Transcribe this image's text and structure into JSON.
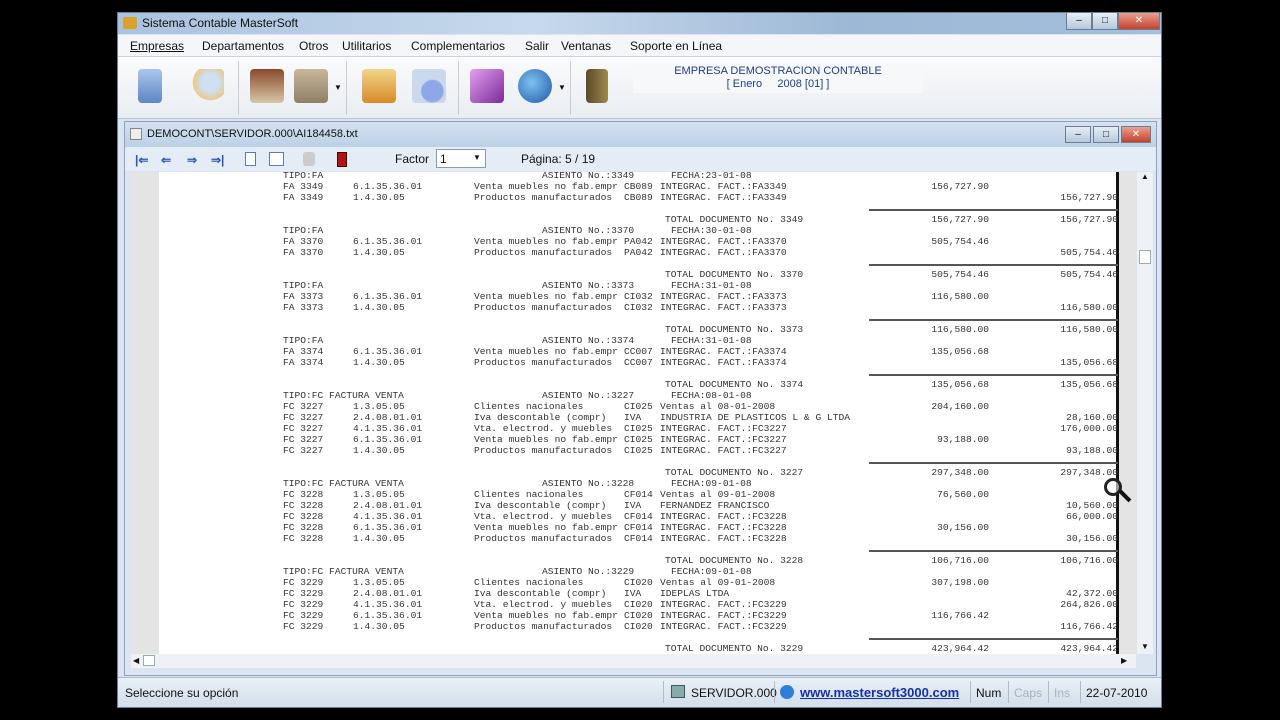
{
  "app": {
    "title": "Sistema Contable MasterSoft"
  },
  "menu": [
    "Empresas",
    "Departamentos",
    "Otros",
    "Utilitarios",
    "Complementarios",
    "Salir",
    "Ventanas",
    "Soporte en Línea"
  ],
  "toolbar": {
    "icons": [
      "calculator-icon",
      "search-documents-icon",
      "home-icon",
      "clock-folder-icon",
      "tools-folder-icon",
      "report-icon",
      "help-book-icon",
      "web-globe-icon",
      "exit-door-icon"
    ],
    "company_name": "EMPRESA DEMOSTRACION CONTABLE",
    "period": "[ Enero     2008 [01] ]"
  },
  "child": {
    "title": "DEMOCONT\\SERVIDOR.000\\AI184458.txt",
    "factor_label": "Factor",
    "factor_value": "1",
    "page_label": "Página: 5 / 19"
  },
  "document": {
    "lines": [
      {
        "k": "h",
        "tipo": "TIPO:FA",
        "asiento": "ASIENTO No.:3349",
        "fecha": "FECHA:23-01-08"
      },
      {
        "k": "e",
        "doc": "FA 3349",
        "cta": "6.1.35.36.01",
        "desc": "Venta muebles no fab.empr",
        "ref": "CB089",
        "det": "INTEGRAC. FACT.:FA3349",
        "debe": "156,727.90",
        "haber": ""
      },
      {
        "k": "e",
        "doc": "FA 3349",
        "cta": "1.4.30.05",
        "desc": "Productos manufacturados",
        "ref": "CB089",
        "det": "INTEGRAC. FACT.:FA3349",
        "debe": "",
        "haber": "156,727.90"
      },
      {
        "k": "r"
      },
      {
        "k": "t",
        "label": "TOTAL DOCUMENTO No. 3349",
        "debe": "156,727.90",
        "haber": "156,727.90"
      },
      {
        "k": "h",
        "tipo": "TIPO:FA",
        "asiento": "ASIENTO No.:3370",
        "fecha": "FECHA:30-01-08"
      },
      {
        "k": "e",
        "doc": "FA 3370",
        "cta": "6.1.35.36.01",
        "desc": "Venta muebles no fab.empr",
        "ref": "PA042",
        "det": "INTEGRAC. FACT.:FA3370",
        "debe": "505,754.46",
        "haber": ""
      },
      {
        "k": "e",
        "doc": "FA 3370",
        "cta": "1.4.30.05",
        "desc": "Productos manufacturados",
        "ref": "PA042",
        "det": "INTEGRAC. FACT.:FA3370",
        "debe": "",
        "haber": "505,754.46"
      },
      {
        "k": "r"
      },
      {
        "k": "t",
        "label": "TOTAL DOCUMENTO No. 3370",
        "debe": "505,754.46",
        "haber": "505,754.46"
      },
      {
        "k": "h",
        "tipo": "TIPO:FA",
        "asiento": "ASIENTO No.:3373",
        "fecha": "FECHA:31-01-08"
      },
      {
        "k": "e",
        "doc": "FA 3373",
        "cta": "6.1.35.36.01",
        "desc": "Venta muebles no fab.empr",
        "ref": "CI032",
        "det": "INTEGRAC. FACT.:FA3373",
        "debe": "116,580.00",
        "haber": ""
      },
      {
        "k": "e",
        "doc": "FA 3373",
        "cta": "1.4.30.05",
        "desc": "Productos manufacturados",
        "ref": "CI032",
        "det": "INTEGRAC. FACT.:FA3373",
        "debe": "",
        "haber": "116,580.00"
      },
      {
        "k": "r"
      },
      {
        "k": "t",
        "label": "TOTAL DOCUMENTO No. 3373",
        "debe": "116,580.00",
        "haber": "116,580.00"
      },
      {
        "k": "h",
        "tipo": "TIPO:FA",
        "asiento": "ASIENTO No.:3374",
        "fecha": "FECHA:31-01-08"
      },
      {
        "k": "e",
        "doc": "FA 3374",
        "cta": "6.1.35.36.01",
        "desc": "Venta muebles no fab.empr",
        "ref": "CC007",
        "det": "INTEGRAC. FACT.:FA3374",
        "debe": "135,056.68",
        "haber": ""
      },
      {
        "k": "e",
        "doc": "FA 3374",
        "cta": "1.4.30.05",
        "desc": "Productos manufacturados",
        "ref": "CC007",
        "det": "INTEGRAC. FACT.:FA3374",
        "debe": "",
        "haber": "135,056.68"
      },
      {
        "k": "r"
      },
      {
        "k": "t",
        "label": "TOTAL DOCUMENTO No. 3374",
        "debe": "135,056.68",
        "haber": "135,056.68"
      },
      {
        "k": "h",
        "tipo": "TIPO:FC FACTURA VENTA",
        "asiento": "ASIENTO No.:3227",
        "fecha": "FECHA:08-01-08"
      },
      {
        "k": "e",
        "doc": "FC 3227",
        "cta": "1.3.05.05",
        "desc": "Clientes nacionales",
        "ref": "CI025",
        "det": "Ventas al 08-01-2008",
        "debe": "204,160.00",
        "haber": ""
      },
      {
        "k": "e",
        "doc": "FC 3227",
        "cta": "2.4.08.01.01",
        "desc": "Iva descontable (compr)",
        "ref": "IVA",
        "det": "INDUSTRIA DE PLASTICOS L & G LTDA",
        "debe": "",
        "haber": "28,160.00"
      },
      {
        "k": "e",
        "doc": "FC 3227",
        "cta": "4.1.35.36.01",
        "desc": "Vta. electrod. y muebles",
        "ref": "CI025",
        "det": "INTEGRAC. FACT.:FC3227",
        "debe": "",
        "haber": "176,000.00"
      },
      {
        "k": "e",
        "doc": "FC 3227",
        "cta": "6.1.35.36.01",
        "desc": "Venta muebles no fab.empr",
        "ref": "CI025",
        "det": "INTEGRAC. FACT.:FC3227",
        "debe": "93,188.00",
        "haber": ""
      },
      {
        "k": "e",
        "doc": "FC 3227",
        "cta": "1.4.30.05",
        "desc": "Productos manufacturados",
        "ref": "CI025",
        "det": "INTEGRAC. FACT.:FC3227",
        "debe": "",
        "haber": "93,188.00"
      },
      {
        "k": "r"
      },
      {
        "k": "t",
        "label": "TOTAL DOCUMENTO No. 3227",
        "debe": "297,348.00",
        "haber": "297,348.00"
      },
      {
        "k": "h",
        "tipo": "TIPO:FC FACTURA VENTA",
        "asiento": "ASIENTO No.:3228",
        "fecha": "FECHA:09-01-08"
      },
      {
        "k": "e",
        "doc": "FC 3228",
        "cta": "1.3.05.05",
        "desc": "Clientes nacionales",
        "ref": "CF014",
        "det": "Ventas al 09-01-2008",
        "debe": "76,560.00",
        "haber": ""
      },
      {
        "k": "e",
        "doc": "FC 3228",
        "cta": "2.4.08.01.01",
        "desc": "Iva descontable (compr)",
        "ref": "IVA",
        "det": "FERNANDEZ FRANCISCO",
        "debe": "",
        "haber": "10,560.00"
      },
      {
        "k": "e",
        "doc": "FC 3228",
        "cta": "4.1.35.36.01",
        "desc": "Vta. electrod. y muebles",
        "ref": "CF014",
        "det": "INTEGRAC. FACT.:FC3228",
        "debe": "",
        "haber": "66,000.00"
      },
      {
        "k": "e",
        "doc": "FC 3228",
        "cta": "6.1.35.36.01",
        "desc": "Venta muebles no fab.empr",
        "ref": "CF014",
        "det": "INTEGRAC. FACT.:FC3228",
        "debe": "30,156.00",
        "haber": ""
      },
      {
        "k": "e",
        "doc": "FC 3228",
        "cta": "1.4.30.05",
        "desc": "Productos manufacturados",
        "ref": "CF014",
        "det": "INTEGRAC. FACT.:FC3228",
        "debe": "",
        "haber": "30,156.00"
      },
      {
        "k": "r"
      },
      {
        "k": "t",
        "label": "TOTAL DOCUMENTO No. 3228",
        "debe": "106,716.00",
        "haber": "106,716.00"
      },
      {
        "k": "h",
        "tipo": "TIPO:FC FACTURA VENTA",
        "asiento": "ASIENTO No.:3229",
        "fecha": "FECHA:09-01-08"
      },
      {
        "k": "e",
        "doc": "FC 3229",
        "cta": "1.3.05.05",
        "desc": "Clientes nacionales",
        "ref": "CI020",
        "det": "Ventas al 09-01-2008",
        "debe": "307,198.00",
        "haber": ""
      },
      {
        "k": "e",
        "doc": "FC 3229",
        "cta": "2.4.08.01.01",
        "desc": "Iva descontable (compr)",
        "ref": "IVA",
        "det": "IDEPLAS LTDA",
        "debe": "",
        "haber": "42,372.00"
      },
      {
        "k": "e",
        "doc": "FC 3229",
        "cta": "4.1.35.36.01",
        "desc": "Vta. electrod. y muebles",
        "ref": "CI020",
        "det": "INTEGRAC. FACT.:FC3229",
        "debe": "",
        "haber": "264,826.00"
      },
      {
        "k": "e",
        "doc": "FC 3229",
        "cta": "6.1.35.36.01",
        "desc": "Venta muebles no fab.empr",
        "ref": "CI020",
        "det": "INTEGRAC. FACT.:FC3229",
        "debe": "116,766.42",
        "haber": ""
      },
      {
        "k": "e",
        "doc": "FC 3229",
        "cta": "1.4.30.05",
        "desc": "Productos manufacturados",
        "ref": "CI020",
        "det": "INTEGRAC. FACT.:FC3229",
        "debe": "",
        "haber": "116,766.42"
      },
      {
        "k": "r"
      },
      {
        "k": "t",
        "label": "TOTAL DOCUMENTO No. 3229",
        "debe": "423,964.42",
        "haber": "423,964.42"
      }
    ]
  },
  "status": {
    "message": "Seleccione su opción",
    "server": "SERVIDOR.000",
    "website": "www.mastersoft3000.com",
    "num": "Num",
    "caps": "Caps",
    "ins": "Ins",
    "date": "22-07-2010"
  }
}
